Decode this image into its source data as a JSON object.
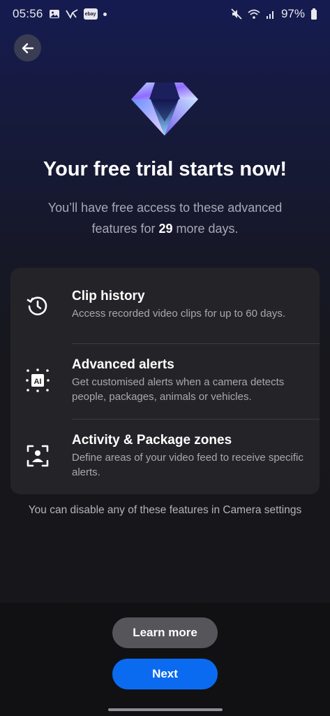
{
  "status_bar": {
    "time": "05:56",
    "notification_icons": [
      "image-icon",
      "vpn-icon",
      "ebay-icon",
      "dot-icon"
    ],
    "ebay_label": "ebay",
    "system_icons": [
      "mute-icon",
      "wifi-icon",
      "signal-icon",
      "battery-icon"
    ],
    "battery": "97%"
  },
  "header": {
    "back_icon": "arrow-left-icon",
    "hero_icon": "diamond-icon"
  },
  "content": {
    "title": "Your free trial starts now!",
    "subtitle_before": "You’ll have free access to these advanced features for ",
    "subtitle_days": "29",
    "subtitle_after": " more days."
  },
  "features": [
    {
      "icon": "history-icon",
      "title": "Clip history",
      "description": "Access recorded video clips for up to 60 days."
    },
    {
      "icon": "ai-icon",
      "title": "Advanced alerts",
      "description": "Get customised alerts when a camera detects people, packages, animals or vehicles."
    },
    {
      "icon": "person-focus-icon",
      "title": "Activity & Package zones",
      "description": "Define areas of your video feed to receive specific alerts."
    }
  ],
  "footnote": "You can disable any of these features in Camera settings",
  "actions": {
    "learn_more": "Learn more",
    "next": "Next"
  },
  "colors": {
    "accent": "#0b6bf0",
    "secondary_button": "#55555a",
    "card": "#242428",
    "background_top": "#151b50",
    "background_bottom": "#17171a"
  }
}
